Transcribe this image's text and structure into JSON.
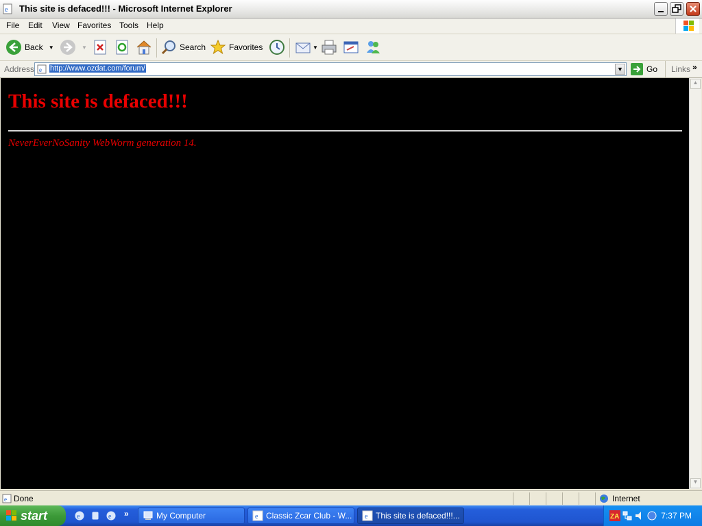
{
  "window": {
    "title": "This site is defaced!!! - Microsoft Internet Explorer"
  },
  "menu": [
    "File",
    "Edit",
    "View",
    "Favorites",
    "Tools",
    "Help"
  ],
  "toolbar": {
    "back": "Back",
    "search": "Search",
    "favorites": "Favorites"
  },
  "address": {
    "label": "Address",
    "url": "http://www.ozdat.com/forum/",
    "go": "Go",
    "links": "Links"
  },
  "page": {
    "title": "This site is defaced!!!",
    "subtitle": "NeverEverNoSanity WebWorm generation 14."
  },
  "status": {
    "text": "Done",
    "zone": "Internet"
  },
  "taskbar": {
    "start": "start",
    "tasks": [
      "My Computer",
      "Classic Zcar Club - W...",
      "This site is defaced!!!..."
    ],
    "clock": "7:37 PM"
  },
  "colors": {
    "page_bg": "#000000",
    "page_text": "#e80000",
    "taskbar": "#245edb"
  }
}
